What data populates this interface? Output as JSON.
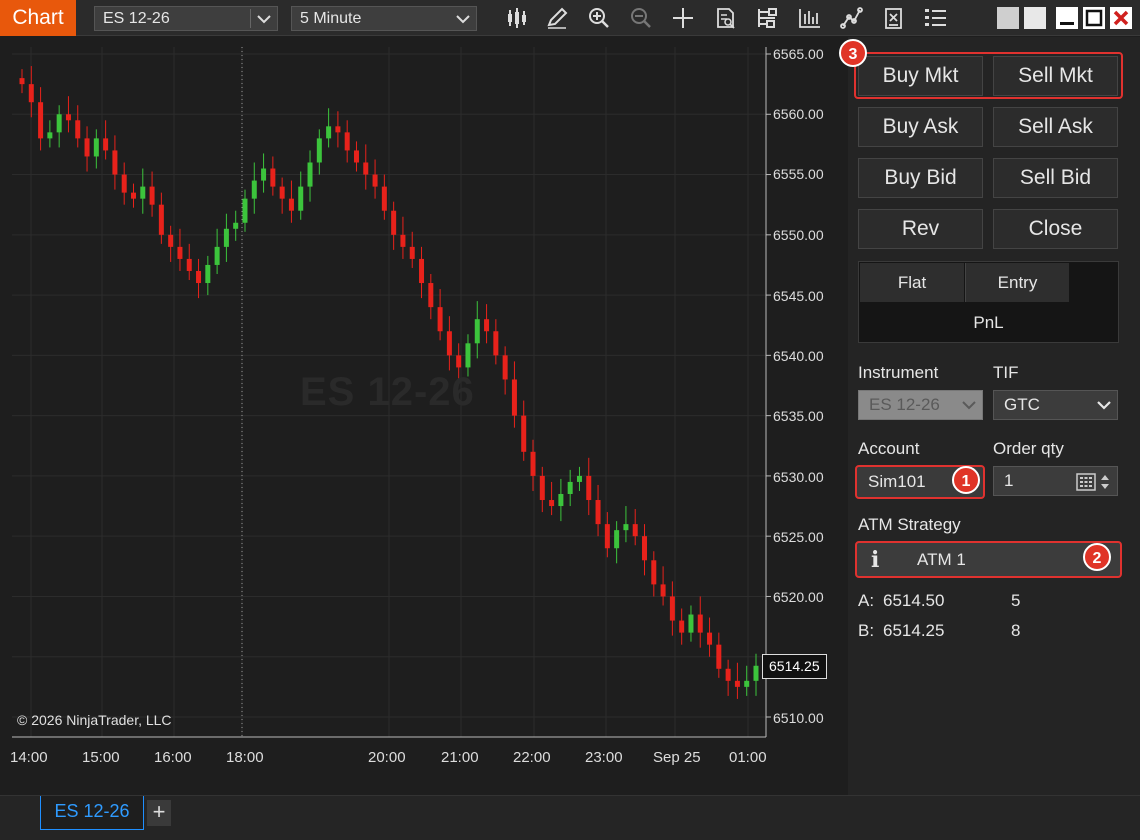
{
  "toolbar": {
    "app_title": "Chart",
    "instrument": "ES 12-26",
    "interval": "5 Minute",
    "icons": [
      "bar-type-icon",
      "draw-pencil-icon",
      "zoom-in-icon",
      "zoom-out-icon",
      "crosshair-icon",
      "data-box-icon",
      "indicators-icon",
      "strategies-icon",
      "drawing-objects-icon",
      "templates-icon",
      "properties-icon"
    ],
    "window_buttons": [
      "restore-grey-icon",
      "restore-light-icon",
      "minimize-icon",
      "maximize-icon",
      "close-icon"
    ]
  },
  "chart": {
    "watermark": "ES 12-26",
    "copyright": "© 2026 NinjaTrader, LLC",
    "last_price": "6514.25",
    "y_ticks": [
      "6565.00",
      "6560.00",
      "6555.00",
      "6550.00",
      "6545.00",
      "6540.00",
      "6535.00",
      "6530.00",
      "6525.00",
      "6520.00",
      "6510.00"
    ],
    "x_ticks": [
      "14:00",
      "15:00",
      "16:00",
      "18:00",
      "20:00",
      "21:00",
      "22:00",
      "23:00",
      "Sep 25",
      "01:00"
    ],
    "up_color": "#3cc43c",
    "down_color": "#e8221b"
  },
  "chart_data": {
    "type": "candlestick",
    "series": [
      {
        "name": "ES 12-26",
        "values": [
          6562.5,
          6561,
          6558,
          6558.5,
          6560,
          6559.5,
          6558,
          6556.5,
          6558,
          6557,
          6555,
          6553.5,
          6553,
          6554,
          6552.5,
          6550,
          6549,
          6548,
          6547,
          6546,
          6547.5,
          6549,
          6550.5,
          6551,
          6553,
          6554.5,
          6555.5,
          6554,
          6553,
          6552,
          6554,
          6556,
          6558,
          6559,
          6558.5,
          6557,
          6556,
          6555,
          6554,
          6552,
          6550,
          6549,
          6548,
          6546,
          6544,
          6542,
          6540,
          6539,
          6541,
          6543,
          6542,
          6540,
          6538,
          6535,
          6532,
          6530,
          6528,
          6527.5,
          6528.5,
          6529.5,
          6530,
          6528,
          6526,
          6524,
          6525.5,
          6526,
          6525,
          6523,
          6521,
          6520,
          6518,
          6517,
          6518.5,
          6517,
          6516,
          6514,
          6513,
          6512.5,
          6513,
          6514.25
        ]
      }
    ],
    "ylim": [
      6509,
      6566
    ]
  },
  "order_panel": {
    "buy_mkt": "Buy Mkt",
    "sell_mkt": "Sell Mkt",
    "buy_ask": "Buy Ask",
    "sell_ask": "Sell Ask",
    "buy_bid": "Buy Bid",
    "sell_bid": "Sell Bid",
    "rev": "Rev",
    "close": "Close",
    "position_flat": "Flat",
    "position_entry": "Entry",
    "pnl": "PnL",
    "instrument_label": "Instrument",
    "instrument_value": "ES 12-26",
    "tif_label": "TIF",
    "tif_value": "GTC",
    "account_label": "Account",
    "account_value": "Sim101",
    "qty_label": "Order qty",
    "qty_value": "1",
    "atm_label": "ATM Strategy",
    "atm_info": "i",
    "atm_value": "ATM 1",
    "ask_label": "A:",
    "ask_price": "6514.50",
    "ask_size": "5",
    "bid_label": "B:",
    "bid_price": "6514.25",
    "bid_size": "8",
    "badges": [
      "1",
      "2",
      "3"
    ],
    "highlight_color": "#e0322f"
  },
  "tabs": {
    "active": "ES 12-26",
    "add": "+"
  },
  "scrollbar": {
    "thumb_grip": "II"
  }
}
